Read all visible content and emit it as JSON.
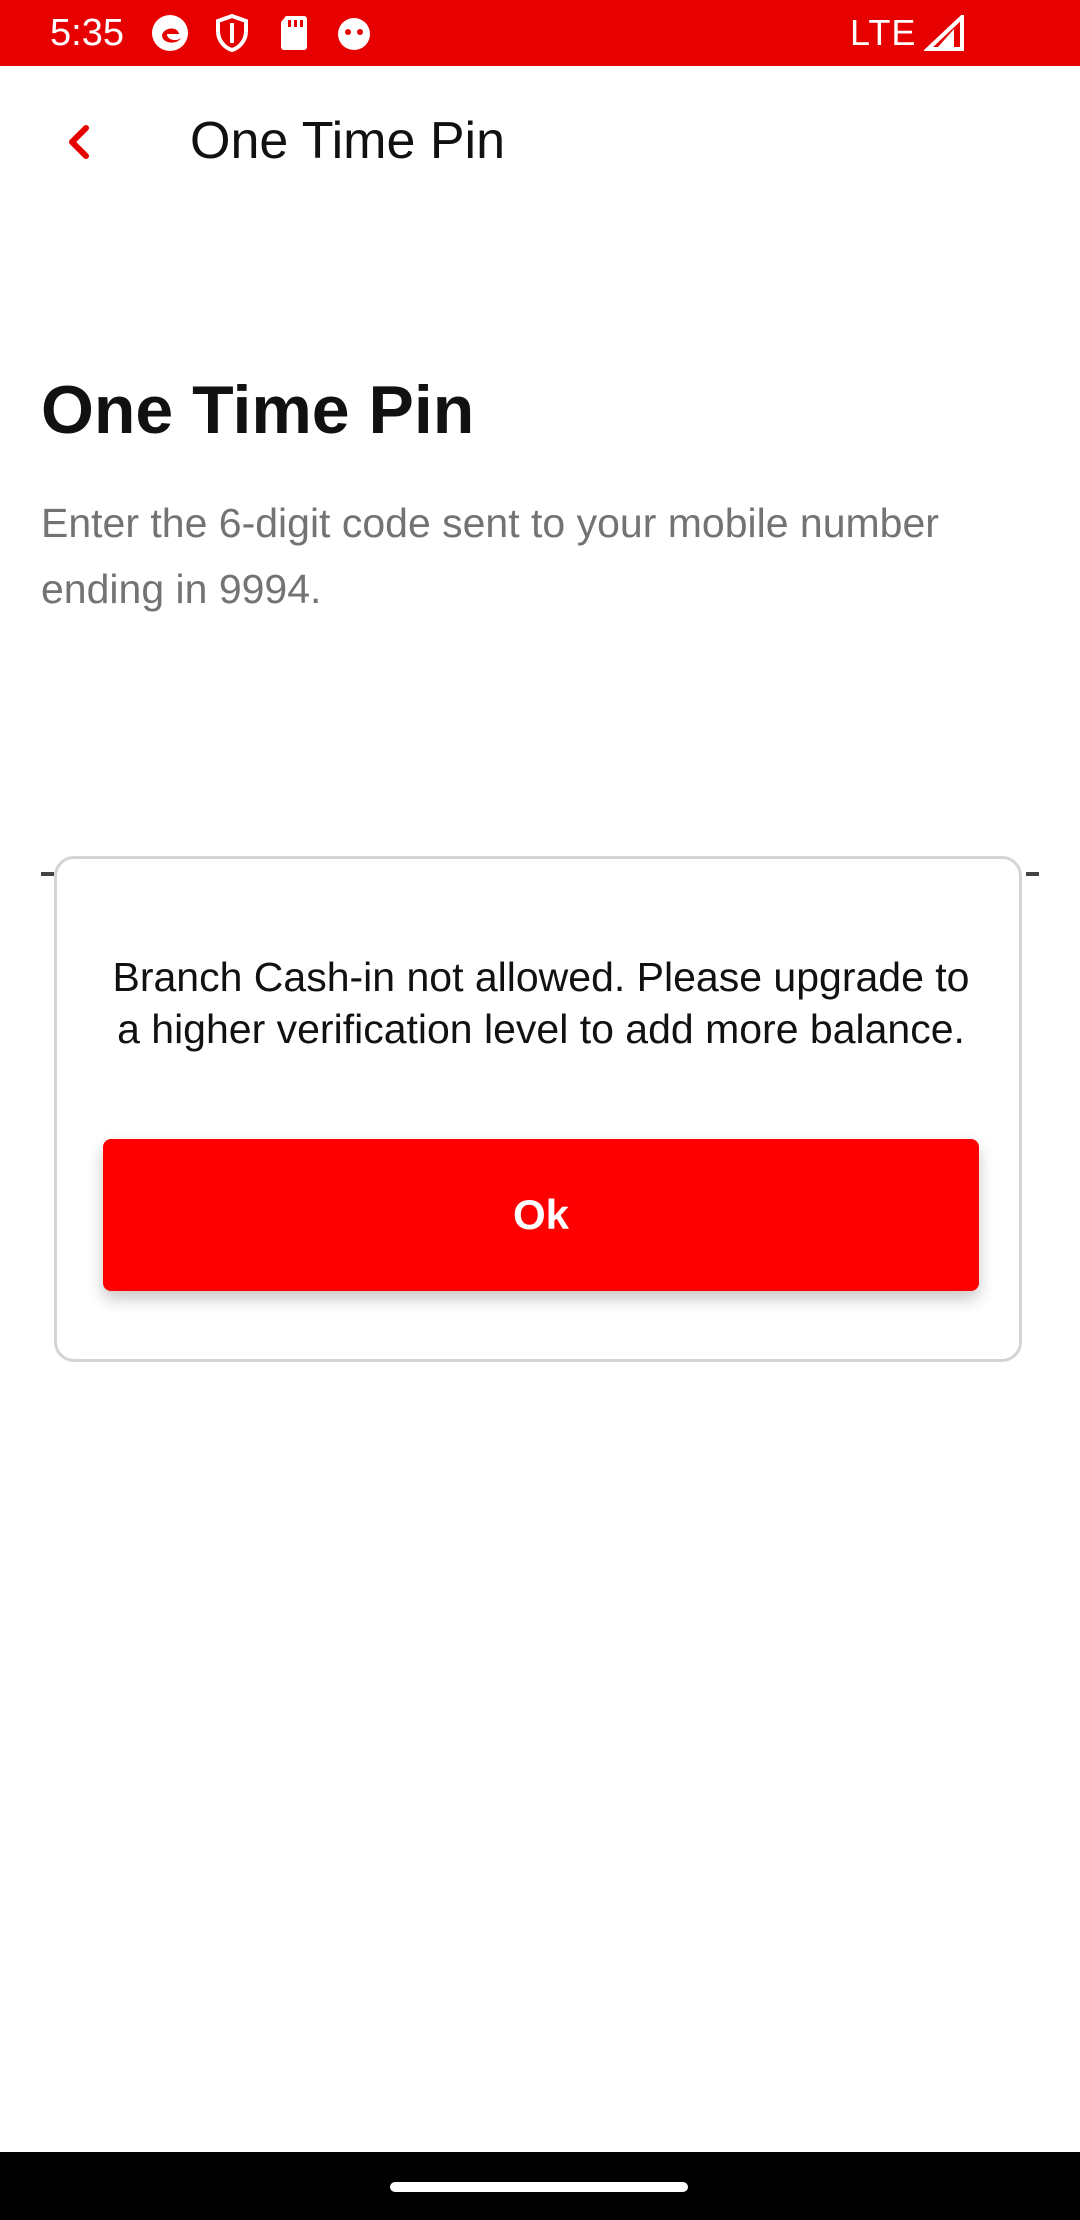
{
  "status_bar": {
    "time": "5:35",
    "network": "LTE",
    "icons": [
      "edge-browser-icon",
      "shield-icon",
      "sd-card-icon",
      "app-notification-icon",
      "signal-icon"
    ],
    "background_color": "#e60000"
  },
  "app_bar": {
    "back_icon": "chevron-left-icon",
    "title": "One Time Pin"
  },
  "content": {
    "heading": "One Time Pin",
    "description": "Enter the 6-digit code sent to your mobile number ending in 9994."
  },
  "dialog": {
    "message": "Branch Cash-in not allowed. Please upgrade to a higher verification level to add more balance.",
    "ok_label": "Ok"
  },
  "colors": {
    "accent": "#ff0000",
    "back_icon": "#e60000"
  }
}
